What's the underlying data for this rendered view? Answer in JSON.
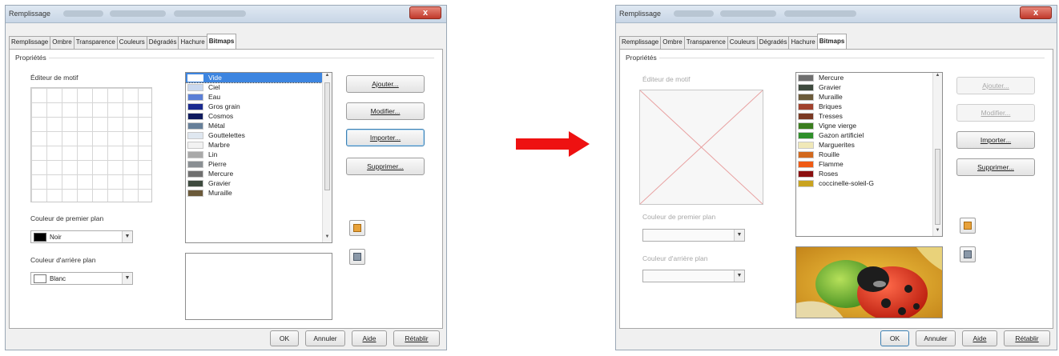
{
  "left_dialog": {
    "title": "Remplissage",
    "close": "x",
    "tabs": [
      "Remplissage",
      "Ombre",
      "Transparence",
      "Couleurs",
      "Dégradés",
      "Hachure",
      "Bitmaps"
    ],
    "active_tab": "Bitmaps",
    "group_label": "Propriétés",
    "pattern_editor_label": "Éditeur de motif",
    "fg_label": "Couleur de premier plan",
    "fg_value": "Noir",
    "fg_color": "#000000",
    "bg_label": "Couleur d'arrière plan",
    "bg_value": "Blanc",
    "bg_color": "#ffffff",
    "bitmaps": [
      {
        "name": "Vide",
        "color": "#ffffff",
        "selected": true
      },
      {
        "name": "Ciel",
        "color": "#c9d8ef"
      },
      {
        "name": "Eau",
        "color": "#5b7fd6"
      },
      {
        "name": "Gros grain",
        "color": "#1a2a8f"
      },
      {
        "name": "Cosmos",
        "color": "#0f1b5e"
      },
      {
        "name": "Métal",
        "color": "#667f99"
      },
      {
        "name": "Gouttelettes",
        "color": "#dfe7f0"
      },
      {
        "name": "Marbre",
        "color": "#f2f2f2"
      },
      {
        "name": "Lin",
        "color": "#a9a9a9"
      },
      {
        "name": "Pierre",
        "color": "#8a8f93"
      },
      {
        "name": "Mercure",
        "color": "#6f6f6f"
      },
      {
        "name": "Gravier",
        "color": "#3e4a3e"
      },
      {
        "name": "Muraille",
        "color": "#6b5a3a"
      }
    ],
    "buttons": {
      "add": "Ajouter...",
      "modify": "Modifier...",
      "import": "Importer...",
      "delete": "Supprimer..."
    },
    "footer": {
      "ok": "OK",
      "cancel": "Annuler",
      "help": "Aide",
      "reset": "Rétablir"
    }
  },
  "arrow_color": "#ee1111",
  "right_dialog": {
    "title": "Remplissage",
    "close": "x",
    "tabs": [
      "Remplissage",
      "Ombre",
      "Transparence",
      "Couleurs",
      "Dégradés",
      "Hachure",
      "Bitmaps"
    ],
    "active_tab": "Bitmaps",
    "group_label": "Propriétés",
    "pattern_editor_label": "Éditeur de motif",
    "fg_label": "Couleur de premier plan",
    "bg_label": "Couleur d'arrière plan",
    "bitmaps": [
      {
        "name": "Mercure",
        "color": "#6f6f6f"
      },
      {
        "name": "Gravier",
        "color": "#3e4a3e"
      },
      {
        "name": "Muraille",
        "color": "#6b5a3a"
      },
      {
        "name": "Briques",
        "color": "#a0412d"
      },
      {
        "name": "Tresses",
        "color": "#7a3a24"
      },
      {
        "name": "Vigne vierge",
        "color": "#3a7d1e"
      },
      {
        "name": "Gazon artificiel",
        "color": "#2f8f2a"
      },
      {
        "name": "Marguerites",
        "color": "#f0e8b8"
      },
      {
        "name": "Rouille",
        "color": "#d2691e"
      },
      {
        "name": "Flamme",
        "color": "#f05a14"
      },
      {
        "name": "Roses",
        "color": "#8b1010"
      },
      {
        "name": "coccinelle-soleil-G",
        "color": "#c9a320"
      }
    ],
    "buttons": {
      "add": "Ajouter...",
      "modify": "Modifier...",
      "import": "Importer...",
      "delete": "Supprimer..."
    },
    "footer": {
      "ok": "OK",
      "cancel": "Annuler",
      "help": "Aide",
      "reset": "Rétablir"
    }
  }
}
